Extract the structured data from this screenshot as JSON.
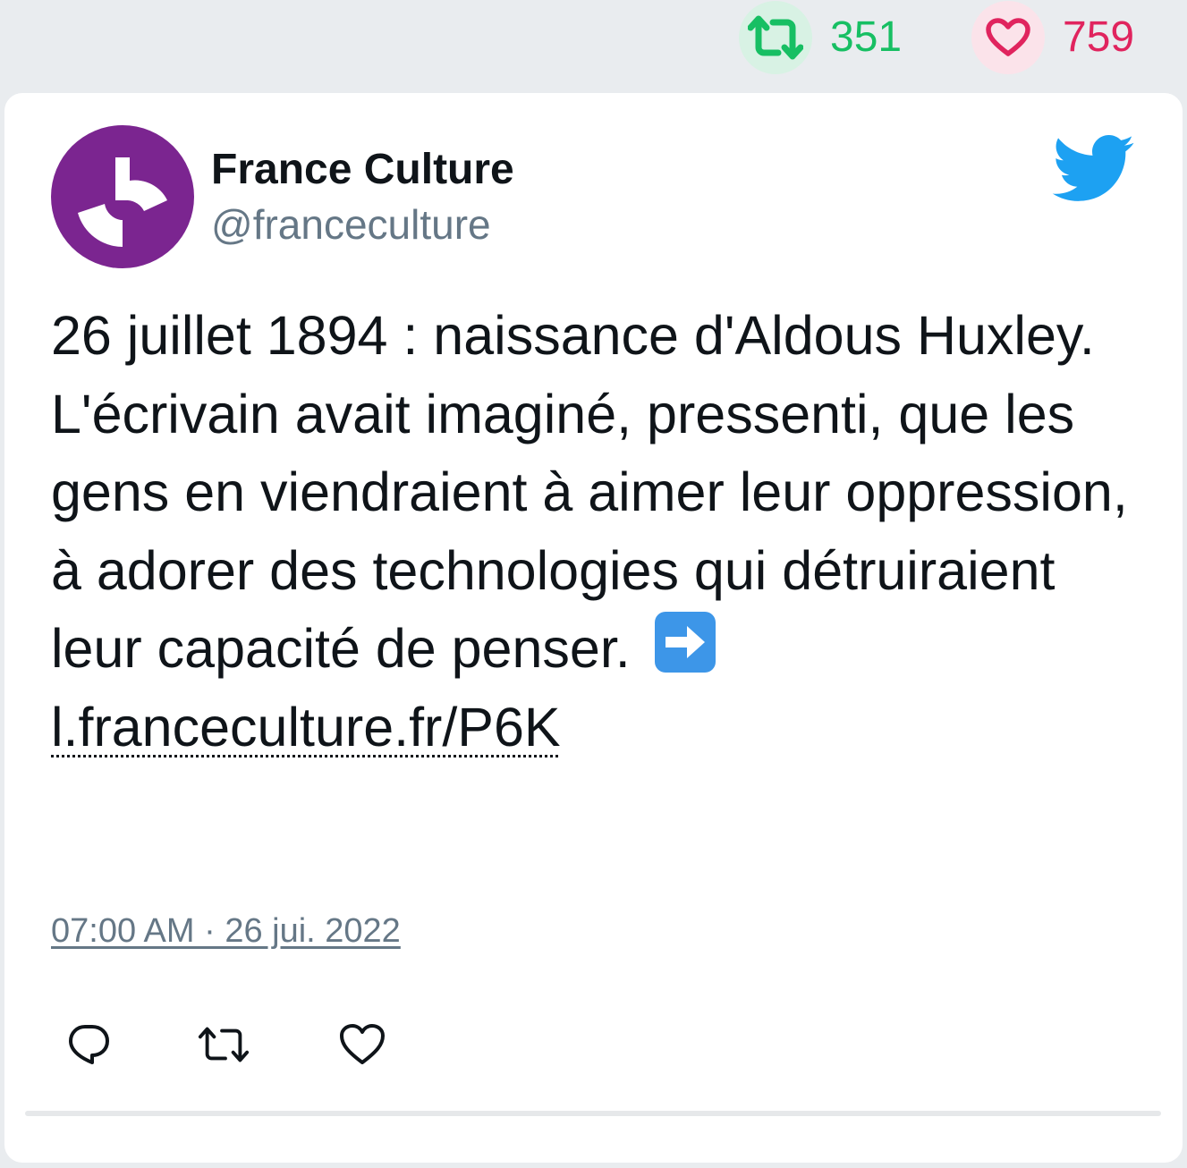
{
  "stats": {
    "retweet_icon": "retweet-icon",
    "retweet_count": "351",
    "like_icon": "heart-icon",
    "like_count": "759",
    "retweet_color": "#17bf63",
    "like_color": "#e0245e"
  },
  "tweet": {
    "author_name": "France Culture",
    "author_handle": "@franceculture",
    "avatar_icon": "france-culture-logo",
    "platform_icon": "twitter-bird-icon",
    "text": "26 juillet 1894 : naissance d'Aldous Huxley. L'écrivain avait imaginé, pressenti, que les gens en viendraient à aimer leur oppression, à adorer des technologies qui détruiraient leur capacité de penser.",
    "emoji": "right-arrow-emoji",
    "link": "l.franceculture.fr/P6K",
    "timestamp": "07:00 AM · 26 jui. 2022",
    "brand_color": "#7b2590",
    "twitter_blue": "#1da1f2"
  },
  "actions": {
    "reply_icon": "reply-icon",
    "retweet_icon": "retweet-icon",
    "like_icon": "heart-icon"
  }
}
